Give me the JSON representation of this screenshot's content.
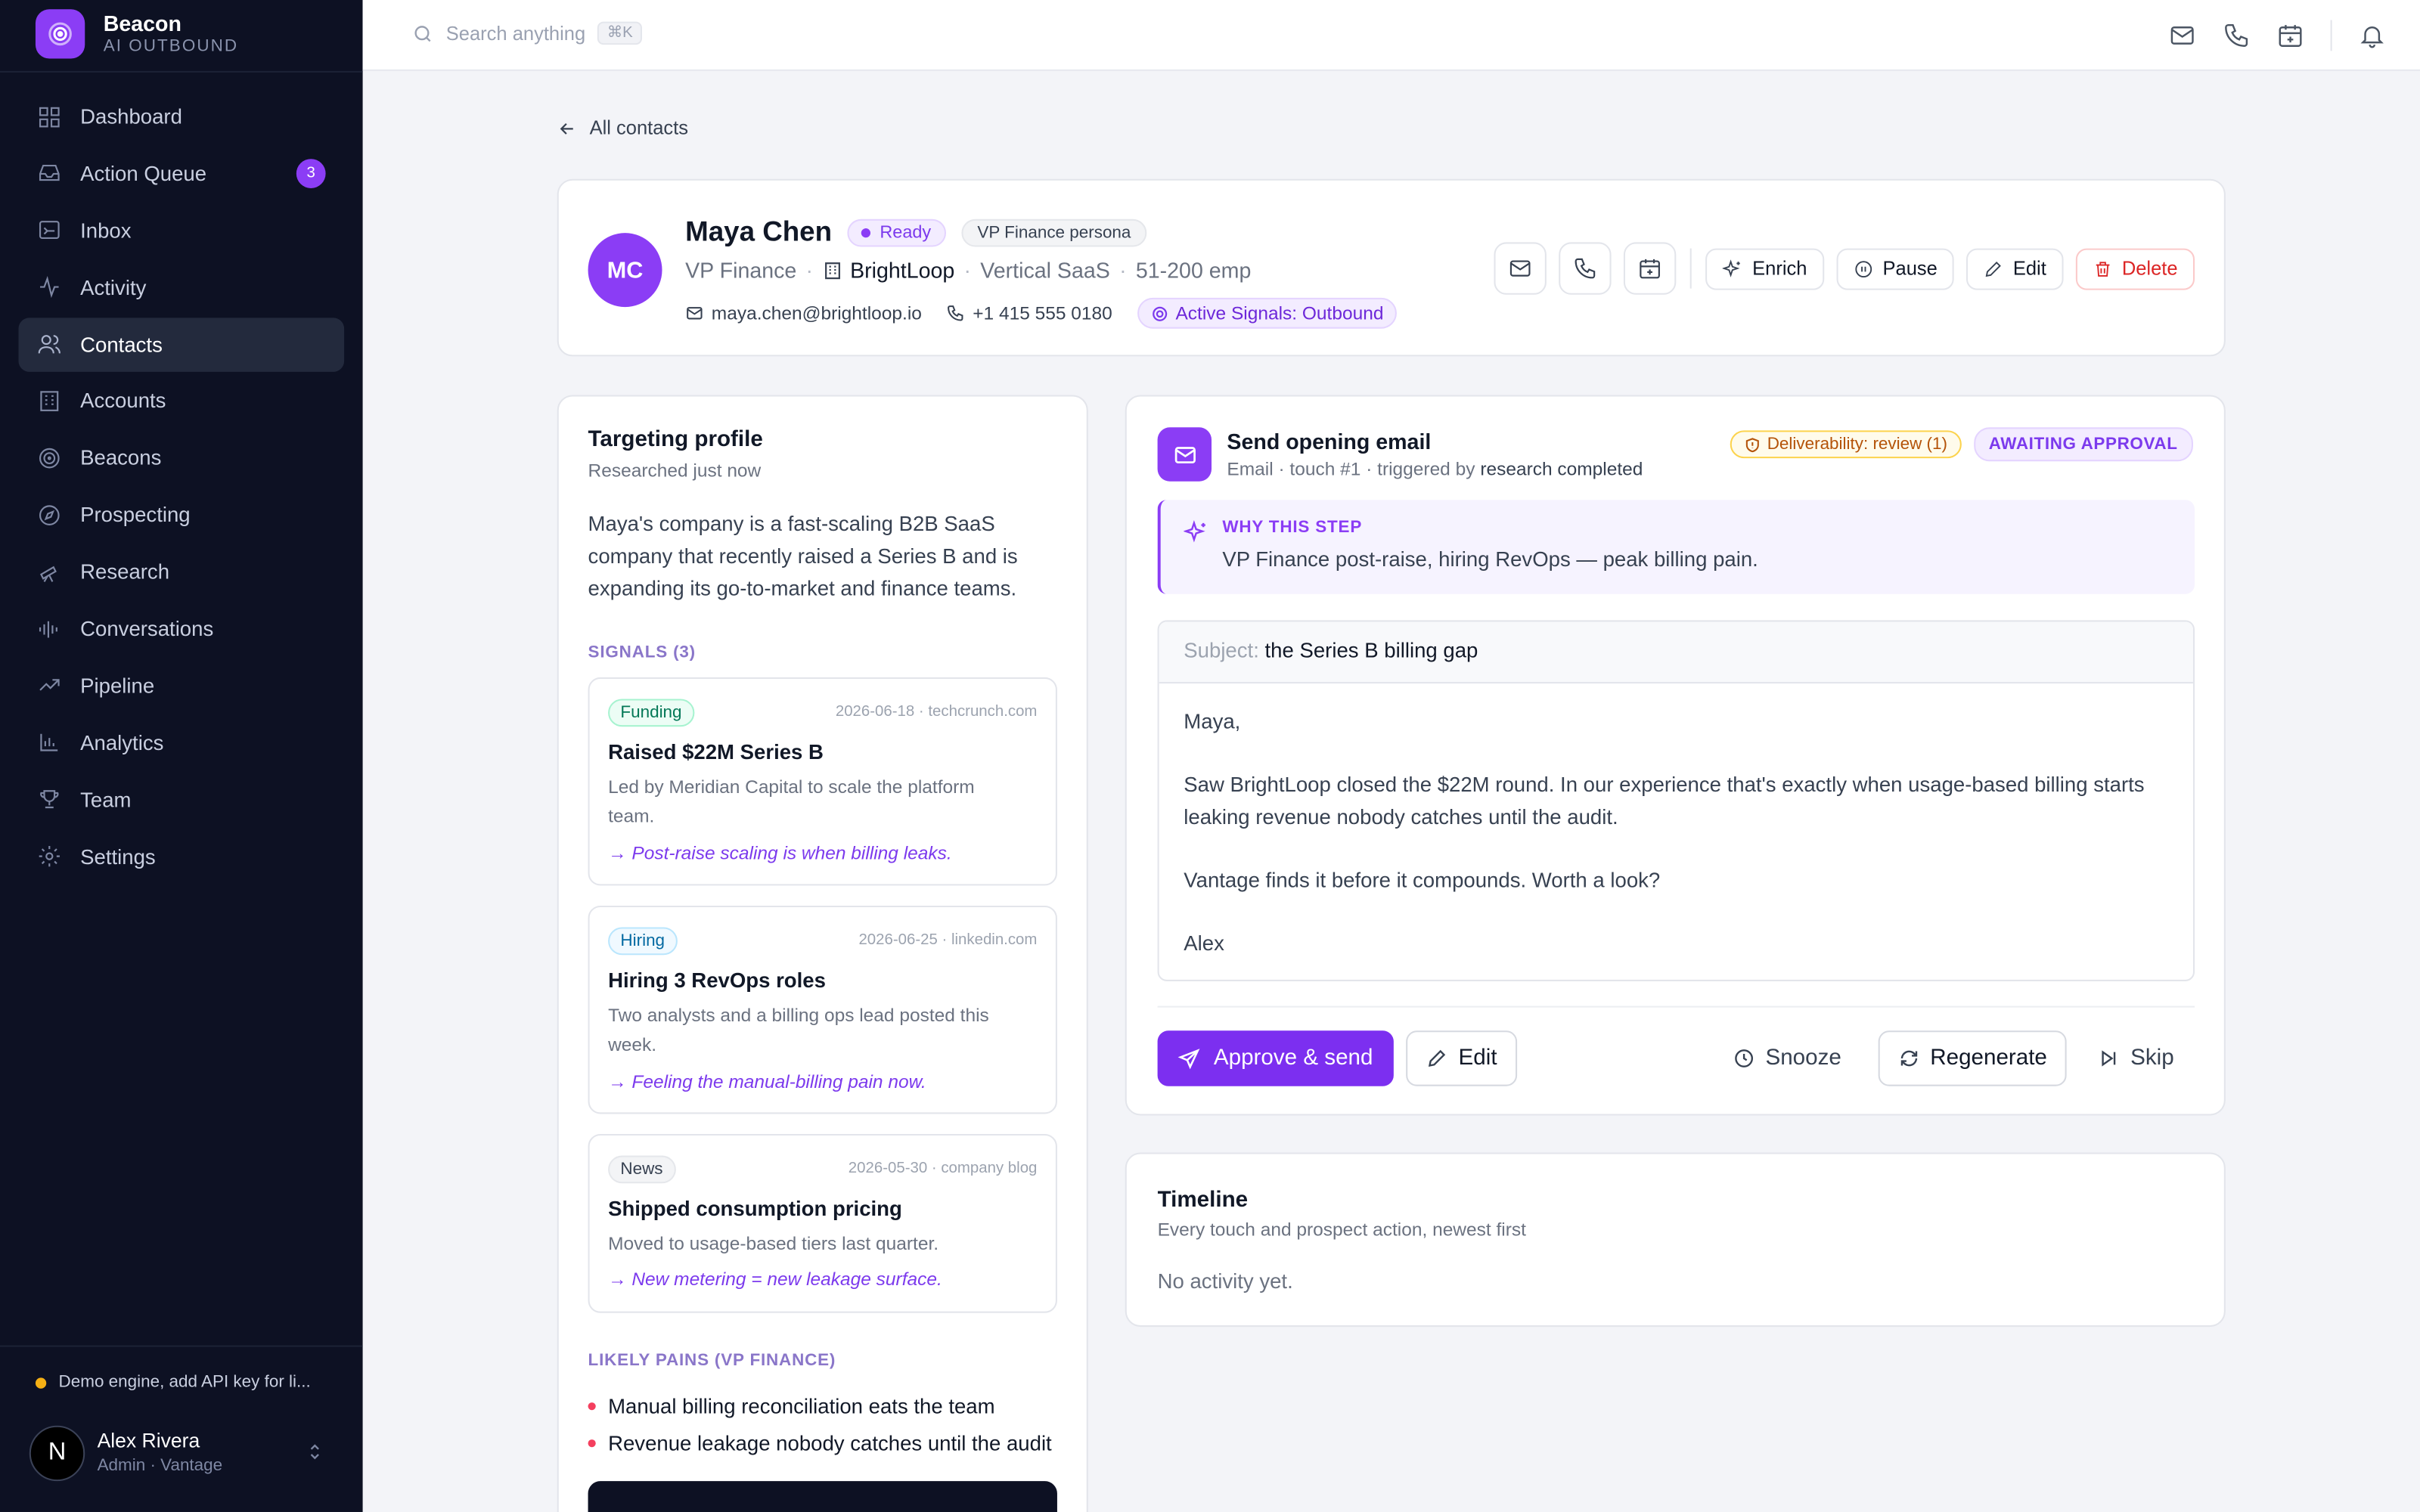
{
  "brand": {
    "name": "Beacon",
    "tagline": "AI OUTBOUND"
  },
  "sidebar": {
    "items": [
      {
        "label": "Dashboard",
        "icon": "grid-icon"
      },
      {
        "label": "Action Queue",
        "icon": "inbox-tray-icon",
        "badge": "3"
      },
      {
        "label": "Inbox",
        "icon": "mail-in-icon"
      },
      {
        "label": "Activity",
        "icon": "activity-icon"
      },
      {
        "label": "Contacts",
        "icon": "users-icon",
        "active": true
      },
      {
        "label": "Accounts",
        "icon": "building-icon"
      },
      {
        "label": "Beacons",
        "icon": "radar-icon"
      },
      {
        "label": "Prospecting",
        "icon": "compass-icon"
      },
      {
        "label": "Research",
        "icon": "telescope-icon"
      },
      {
        "label": "Conversations",
        "icon": "waveform-icon"
      },
      {
        "label": "Pipeline",
        "icon": "trending-up-icon"
      },
      {
        "label": "Analytics",
        "icon": "bar-chart-icon"
      },
      {
        "label": "Team",
        "icon": "trophy-icon"
      },
      {
        "label": "Settings",
        "icon": "gear-icon"
      }
    ],
    "demo_notice": "Demo engine, add API key for li...",
    "user": {
      "initial": "N",
      "name": "Alex Rivera",
      "role": "Admin · Vantage"
    }
  },
  "topbar": {
    "search_placeholder": "Search anything",
    "shortcut": "⌘K"
  },
  "back_link": "All contacts",
  "contact": {
    "initials": "MC",
    "name": "Maya Chen",
    "status": "Ready",
    "persona": "VP Finance persona",
    "title": "VP Finance",
    "company": "BrightLoop",
    "industry": "Vertical SaaS",
    "size": "51-200 emp",
    "email": "maya.chen@brightloop.io",
    "phone": "+1 415 555 0180",
    "signals_pill": "Active Signals: Outbound",
    "actions": {
      "enrich": "Enrich",
      "pause": "Pause",
      "edit": "Edit",
      "delete": "Delete"
    }
  },
  "targeting": {
    "title": "Targeting profile",
    "subtitle": "Researched just now",
    "description": "Maya's company is a fast-scaling B2B SaaS company that recently raised a Series B and is expanding its go-to-market and finance teams.",
    "signals_label": "SIGNALS (3)",
    "signals": [
      {
        "tag": "Funding",
        "meta": "2026-06-18 · techcrunch.com",
        "title": "Raised $22M Series B",
        "desc": "Led by Meridian Capital to scale the platform team.",
        "insight": "→ Post-raise scaling is when billing leaks."
      },
      {
        "tag": "Hiring",
        "meta": "2026-06-25 · linkedin.com",
        "title": "Hiring 3 RevOps roles",
        "desc": "Two analysts and a billing ops lead posted this week.",
        "insight": "→ Feeling the manual-billing pain now."
      },
      {
        "tag": "News",
        "meta": "2026-05-30 · company blog",
        "title": "Shipped consumption pricing",
        "desc": "Moved to usage-based tiers last quarter.",
        "insight": "→ New metering = new leakage surface."
      }
    ],
    "pains_label": "LIKELY PAINS (VP FINANCE)",
    "pains": [
      "Manual billing reconciliation eats the team",
      "Revenue leakage nobody catches until the audit"
    ]
  },
  "email_step": {
    "title": "Send opening email",
    "subtitle_prefix": "Email · touch #1 · triggered by",
    "trigger": "research completed",
    "deliverability": "Deliverability: review (1)",
    "status": "AWAITING APPROVAL",
    "why_label": "WHY THIS STEP",
    "why_text": "VP Finance post-raise, hiring RevOps — peak billing pain.",
    "subject_label": "Subject:",
    "subject": "the Series B billing gap",
    "body": [
      "Maya,",
      "Saw BrightLoop closed the $22M round. In our experience that's exactly when usage-based billing starts leaking revenue nobody catches until the audit.",
      "Vantage finds it before it compounds. Worth a look?",
      "Alex"
    ],
    "buttons": {
      "approve": "Approve & send",
      "edit": "Edit",
      "snooze": "Snooze",
      "regenerate": "Regenerate",
      "skip": "Skip"
    }
  },
  "timeline": {
    "title": "Timeline",
    "subtitle": "Every touch and prospect action, newest first",
    "empty": "No activity yet."
  },
  "colors": {
    "accent": "#8b3df5",
    "sidebar_bg": "#0d1123",
    "danger": "#dc2626"
  }
}
